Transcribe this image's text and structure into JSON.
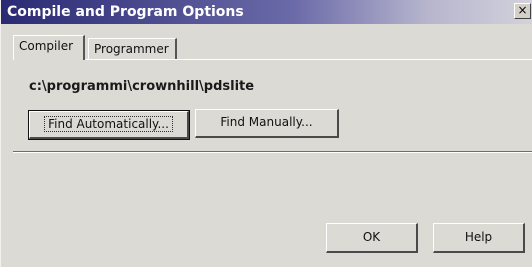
{
  "window": {
    "title": "Compile and Program Options",
    "close_glyph": "×"
  },
  "tabs": [
    {
      "label": "Compiler",
      "active": true
    },
    {
      "label": "Programmer",
      "active": false
    }
  ],
  "compiler": {
    "path": "c:\\programmi\\crownhill\\pdslite",
    "find_auto_label": "Find Automatically...",
    "find_manual_label": "Find Manually..."
  },
  "footer": {
    "ok_label": "OK",
    "help_label": "Help"
  },
  "colors": {
    "title_gradient_start": "#2a2a74",
    "title_gradient_end": "#d3d2dc",
    "dialog_bg": "#dcdad5"
  },
  "icons": {
    "close": "close-icon"
  }
}
